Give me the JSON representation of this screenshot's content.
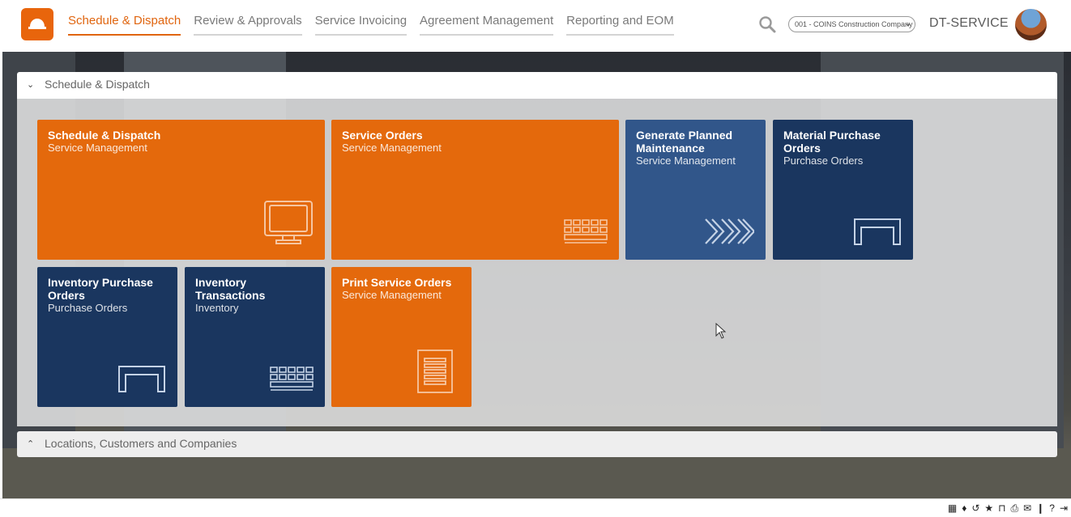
{
  "nav": {
    "items": [
      {
        "label": "Schedule & Dispatch",
        "active": true
      },
      {
        "label": "Review & Approvals",
        "active": false
      },
      {
        "label": "Service Invoicing",
        "active": false
      },
      {
        "label": "Agreement Management",
        "active": false
      },
      {
        "label": "Reporting and EOM",
        "active": false
      }
    ]
  },
  "header": {
    "company": "001 - COINS Construction Company",
    "user": "DT-SERVICE"
  },
  "panel": {
    "title": "Schedule & Dispatch"
  },
  "tiles": [
    {
      "title": "Schedule & Dispatch",
      "subtitle": "Service Management",
      "icon": "monitor-icon"
    },
    {
      "title": "Service Orders",
      "subtitle": "Service Management",
      "icon": "keyboard-icon"
    },
    {
      "title": "Generate Planned Maintenance",
      "subtitle": "Service Management",
      "icon": "chevrons-right-icon"
    },
    {
      "title": "Material Purchase Orders",
      "subtitle": "Purchase Orders",
      "icon": "desk-icon"
    },
    {
      "title": "Inventory Purchase Orders",
      "subtitle": "Purchase Orders",
      "icon": "desk-icon"
    },
    {
      "title": "Inventory Transactions",
      "subtitle": "Inventory",
      "icon": "keyboard-icon"
    },
    {
      "title": "Print Service Orders",
      "subtitle": "Service Management",
      "icon": "document-icon"
    }
  ],
  "panel2": {
    "title": "Locations, Customers and Companies"
  },
  "colors": {
    "accent": "#e4690c",
    "steel": "#31568a",
    "navy": "#1a365f"
  }
}
